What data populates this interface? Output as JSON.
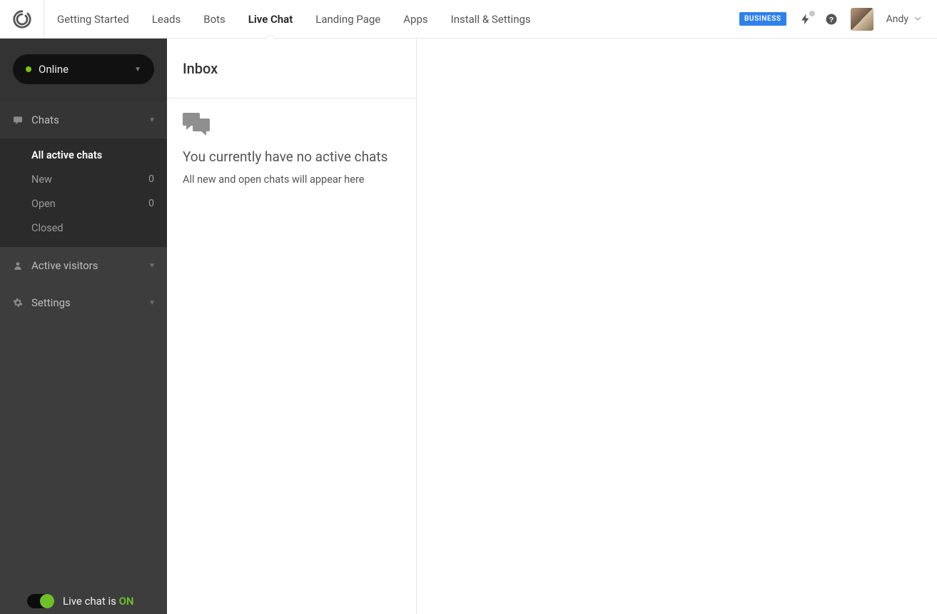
{
  "header": {
    "nav": [
      {
        "label": "Getting Started",
        "active": false
      },
      {
        "label": "Leads",
        "active": false
      },
      {
        "label": "Bots",
        "active": false
      },
      {
        "label": "Live Chat",
        "active": true
      },
      {
        "label": "Landing Page",
        "active": false
      },
      {
        "label": "Apps",
        "active": false
      },
      {
        "label": "Install & Settings",
        "active": false
      }
    ],
    "plan_badge": "BUSINESS",
    "user_name": "Andy"
  },
  "sidebar": {
    "status_label": "Online",
    "sections": {
      "chats_title": "Chats",
      "chat_items": [
        {
          "label": "All active chats",
          "count": null,
          "active": true
        },
        {
          "label": "New",
          "count": "0",
          "active": false
        },
        {
          "label": "Open",
          "count": "0",
          "active": false
        },
        {
          "label": "Closed",
          "count": null,
          "active": false
        }
      ],
      "visitors_title": "Active visitors",
      "settings_title": "Settings"
    },
    "bottom": {
      "prefix": "Live chat is ",
      "on": "ON"
    }
  },
  "inbox": {
    "title": "Inbox",
    "empty_title": "You currently have no active chats",
    "empty_sub": "All new and open chats will appear here"
  }
}
